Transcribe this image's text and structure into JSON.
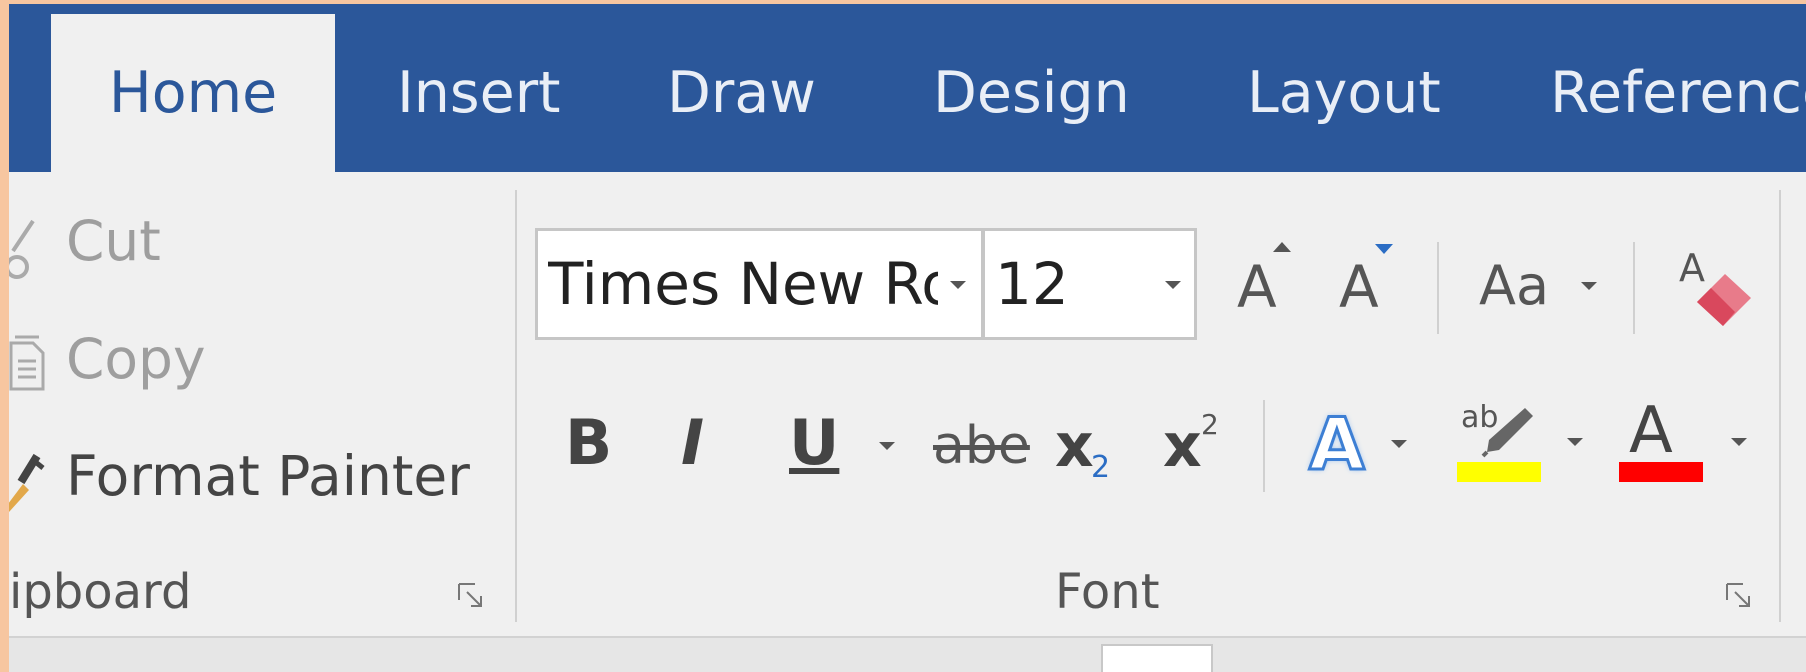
{
  "tabs": [
    {
      "label": "Home",
      "active": true
    },
    {
      "label": "Insert",
      "active": false
    },
    {
      "label": "Draw",
      "active": false
    },
    {
      "label": "Design",
      "active": false
    },
    {
      "label": "Layout",
      "active": false
    },
    {
      "label": "Reference",
      "active": false
    }
  ],
  "clipboard": {
    "cut_label": "Cut",
    "copy_label": "Copy",
    "format_painter_label": "Format Painter",
    "group_label": "ipboard"
  },
  "font": {
    "font_name": "Times New Ro",
    "font_size": "12",
    "change_case_label": "Aa",
    "group_label": "Font",
    "bold_label": "B",
    "italic_label": "I",
    "underline_label": "U",
    "strikethrough_label": "abe",
    "subscript_label": "x",
    "subscript_digit": "2",
    "superscript_label": "x",
    "superscript_digit": "2",
    "grow_font_label": "A",
    "shrink_font_label": "A",
    "text_effects_label": "A",
    "highlight_label": "ab",
    "font_color_label": "A",
    "clear_format_label": "A"
  },
  "colors": {
    "tab_bar": "#2b579a",
    "highlight_color": "#ffff00",
    "font_color": "#ff0000",
    "accent_blue": "#2b579a"
  }
}
